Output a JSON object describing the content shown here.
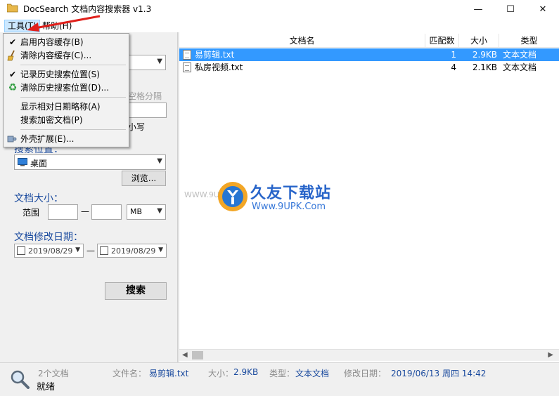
{
  "window": {
    "title": "DocSearch 文档内容搜索器 v1.3",
    "minimize_glyph": "—",
    "maximize_glyph": "☐",
    "close_glyph": "✕"
  },
  "menubar": {
    "tools": "工具(T)",
    "help": "帮助(H)"
  },
  "tools_menu": {
    "items": [
      {
        "label": "启用内容缓存(B)",
        "icon": "checkmark-icon",
        "glyph": "✔"
      },
      {
        "label": "清除内容缓存(C)...",
        "icon": "broom-icon",
        "glyph": ""
      },
      {
        "label": "记录历史搜索位置(S)",
        "icon": "checkmark-icon",
        "glyph": "✔"
      },
      {
        "label": "清除历史搜索位置(D)...",
        "icon": "recycle-icon",
        "glyph": "♻"
      },
      {
        "label": "显示相对日期略称(A)",
        "icon": "",
        "glyph": ""
      },
      {
        "label": "搜索加密文档(P)",
        "icon": "",
        "glyph": ""
      },
      {
        "label": "外壳扩展(E)...",
        "icon": "puzzle-icon",
        "glyph": ""
      }
    ]
  },
  "left_panel": {
    "keyword_hint_partial": "空格分隔",
    "case_partial": "小写",
    "search_location_label": "搜索位置：",
    "location_value": "桌面",
    "browse_button": "浏览...",
    "size_label": "文档大小：",
    "range_label": "范围",
    "range_dash": "—",
    "size_unit": "MB",
    "modified_label": "文档修改日期：",
    "date_from": "2019/08/29",
    "date_to": "2019/08/29",
    "date_dash": "—",
    "search_button": "搜索"
  },
  "table": {
    "columns": [
      "文档名",
      "匹配数",
      "大小",
      "类型"
    ],
    "rows": [
      {
        "name": "易剪辑.txt",
        "matches": "1",
        "size": "2.9KB",
        "type": "文本文档",
        "selected": true
      },
      {
        "name": "私房视频.txt",
        "matches": "4",
        "size": "2.1KB",
        "type": "文本文档",
        "selected": false
      }
    ]
  },
  "watermark": {
    "brand": "久友下载站",
    "url": "Www.9UPK.Com",
    "faint_url": "WWW.9U"
  },
  "statusbar": {
    "doc_count": "2个文档",
    "ready": "就绪",
    "filename_label": "文件名：",
    "filename_value": "易剪辑.txt",
    "size_label": "大小：",
    "size_value": "2.9KB",
    "type_label": "类型：",
    "type_value": "文本文档",
    "modified_label": "修改日期：",
    "modified_value": "2019/06/13 周四 14:42"
  },
  "colors": {
    "selection": "#3399ff",
    "label_blue": "#1a4a9e",
    "menu_highlight": "#cce8ff",
    "arrow_red": "#e0201b"
  }
}
